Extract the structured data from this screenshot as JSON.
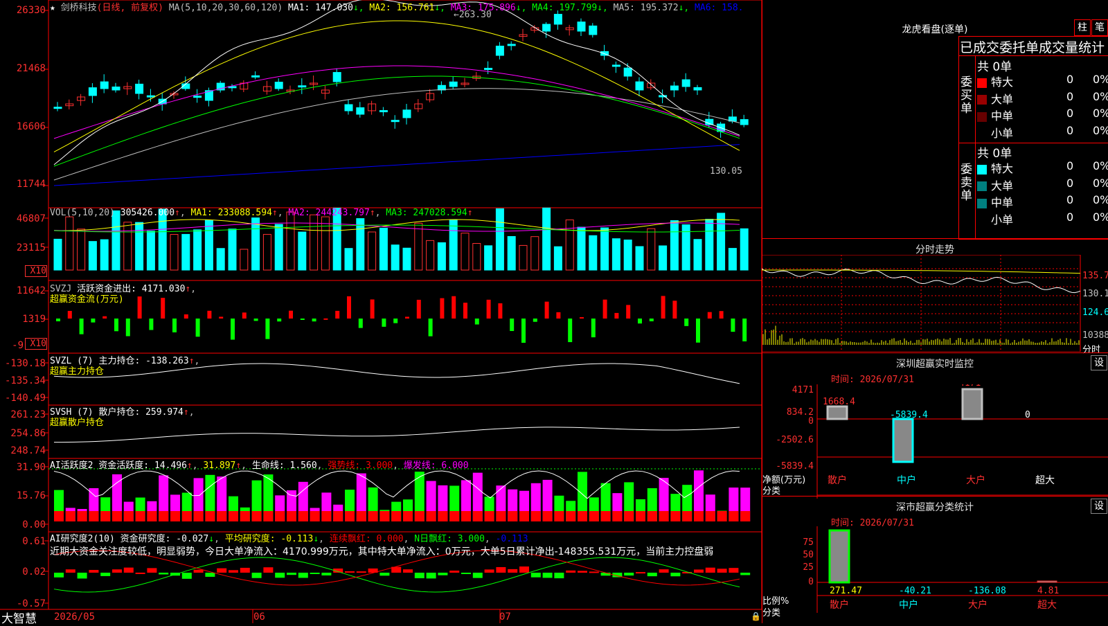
{
  "stock": {
    "name": "剑桥科技",
    "mode": "(日线, 前复权)",
    "ma_header": "MA(5,10,20,30,60,120)",
    "ma": [
      {
        "label": "MA1:",
        "value": "147.030",
        "arrow": "↓",
        "color": "#ffffff"
      },
      {
        "label": "MA2:",
        "value": "156.761",
        "arrow": "↓",
        "color": "#ffff00"
      },
      {
        "label": "MA3:",
        "value": "175.896",
        "arrow": "↓",
        "color": "#ff00ff"
      },
      {
        "label": "MA4:",
        "value": "197.799",
        "arrow": "↓",
        "color": "#00ff00"
      },
      {
        "label": "MA5:",
        "value": "195.372",
        "arrow": "↓",
        "color": "#c0c0c0"
      },
      {
        "label": "MA6:",
        "value": "158.",
        "arrow": "",
        "color": "#0000ff"
      }
    ],
    "high_label": "263.30",
    "low_label": "130.05"
  },
  "axes": {
    "price": [
      "26330",
      "21468",
      "16606",
      "11744"
    ],
    "vol": [
      "46807",
      "23115",
      "X10"
    ],
    "svzj": [
      "11642",
      "1319",
      "-9",
      "X10"
    ],
    "svzl": [
      "-130.18",
      "-135.34",
      "-140.49"
    ],
    "svsh": [
      "261.23",
      "254.86",
      "248.74"
    ],
    "ai": [
      "31.90",
      "15.76",
      "0.00"
    ],
    "ai2": [
      "0.61",
      "0.02",
      "-0.57"
    ]
  },
  "indicators": {
    "vol": {
      "head": "VOL(5,10,20)",
      "value": "305426.000",
      "ma1": "MA1: 233088.594",
      "ma2": "MA2: 244243.797",
      "ma3": "MA3: 247028.594"
    },
    "svzj": {
      "head": "SVZJ",
      "label": "活跃资金进出: 4171.030",
      "sub": "超赢资金流(万元)"
    },
    "svzl": {
      "head": "SVZL (7) 主力持仓: -138.263",
      "sub": "超赢主力持仓"
    },
    "svsh": {
      "head": "SVSH (7) 散户持仓: 259.974",
      "sub": "超赢散户持仓"
    },
    "ai": {
      "head": "AI活跃度2 资金活跃度: 14.496",
      "v2": "31.897",
      "v3": "生命线: 1.560",
      "v4": "强势线: 3.000",
      "v5": "爆发线: 6.000"
    },
    "ai2": {
      "head": "AI研究度2(10) 资金研究度: -0.027",
      "v2": "平均研究度: -0.113",
      "v3": "连续飘红: 0.000",
      "v4": "N日飘红: 3.000",
      "v5": "-0.113",
      "comment": "近期大资金关注度较低，明显弱势，今日大单净流入：4170.999万元，其中特大单净流入：0万元，大单5日累计净出-148355.531万元，当前主力控盘弱"
    }
  },
  "bottom": {
    "brand": "大智慧",
    "d1": "2026/05",
    "d2": "06",
    "d3": "07"
  },
  "right": {
    "dragon": "龙虎看盘(逐单)",
    "btn1": "柱",
    "btn2": "笔",
    "stat_title": "已成交委托单成交量统计",
    "buy": {
      "label": "委买单",
      "total": "共 0单",
      "rows": [
        {
          "name": "特大",
          "v": "0",
          "p": "0%",
          "c": "#ff0000"
        },
        {
          "name": "大单",
          "v": "0",
          "p": "0%",
          "c": "#990000"
        },
        {
          "name": "中单",
          "v": "0",
          "p": "0%",
          "c": "#660000"
        },
        {
          "name": "小单",
          "v": "0",
          "p": "0%",
          "c": "#000000"
        }
      ]
    },
    "sell": {
      "label": "委卖单",
      "total": "共 0单",
      "rows": [
        {
          "name": "特大",
          "v": "0",
          "p": "0%",
          "c": "#00ffff"
        },
        {
          "name": "大单",
          "v": "0",
          "p": "0%",
          "c": "#008080"
        },
        {
          "name": "中单",
          "v": "0",
          "p": "0%",
          "c": "#008080"
        },
        {
          "name": "小单",
          "v": "0",
          "p": "0%",
          "c": "#000000"
        }
      ]
    },
    "intraday": {
      "title": "分时走势",
      "p1": "135.7",
      "p2": "130.1",
      "p3": "124.6",
      "vol": "10388",
      "vlabel": "分时"
    },
    "monitor": {
      "title": "深圳超赢实时监控",
      "btn": "设",
      "time": "时间: 2026/07/31",
      "y": [
        "4171",
        "834.2",
        "0",
        "-2502.6",
        "-5839.4"
      ],
      "bars": [
        "1668.4",
        "-5839.4",
        "4171",
        "0"
      ],
      "ylabel": "净额(万元)",
      "xlabel": "分类",
      "cats": [
        "散户",
        "中户",
        "大户",
        "超大"
      ]
    },
    "classify": {
      "title": "深市超赢分类统计",
      "btn": "设",
      "time": "时间: 2026/07/31",
      "y": [
        "75",
        "50",
        "25",
        "0"
      ],
      "vals": [
        "271.47",
        "-40.21",
        "-136.08",
        "4.81"
      ],
      "ylabel": "比例%",
      "xlabel": "分类",
      "cats": [
        "散户",
        "中户",
        "大户",
        "超大"
      ]
    }
  }
}
